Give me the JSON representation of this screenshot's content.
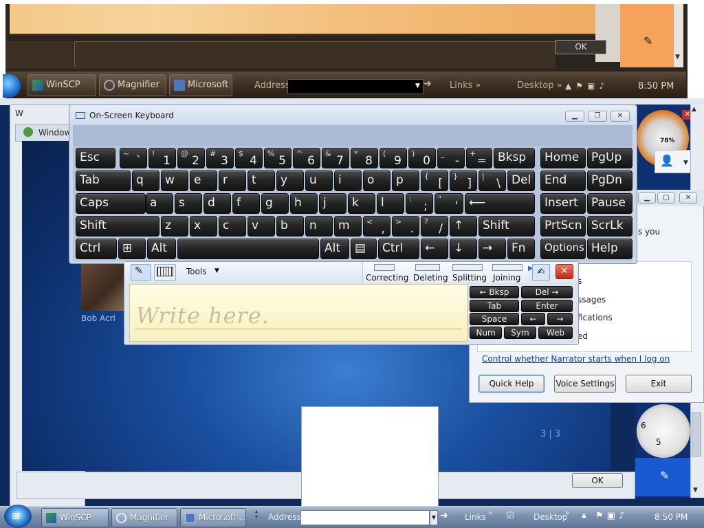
{
  "magnifier": {
    "ok_label": "OK",
    "taskbar": {
      "items": [
        {
          "label": "WinSCP"
        },
        {
          "label": "Magnifier"
        },
        {
          "label": "Microsoft ..."
        }
      ],
      "address_label": "Address",
      "links_label": "Links",
      "desktop_label": "Desktop",
      "clock": "8:50 PM"
    }
  },
  "background": {
    "window_title": "Window",
    "window_title_short": "W",
    "contact_name": "Bob Acri",
    "page_indicator": "3 | 3",
    "ok_label": "OK",
    "battery_percent": "78%"
  },
  "narrator": {
    "text_you": "s you",
    "partial_lines": [
      "s",
      "ssages",
      "fications",
      "ed"
    ],
    "link": "Control whether Narrator starts when I log on",
    "buttons": {
      "quick_help": "Quick Help",
      "voice_settings": "Voice Settings",
      "exit": "Exit"
    }
  },
  "osk": {
    "title": "On-Screen Keyboard",
    "rows": {
      "r1": [
        {
          "lbl": "Esc"
        },
        {
          "top": "~",
          "bot": "`"
        },
        {
          "top": "!",
          "bot": "1"
        },
        {
          "top": "@",
          "bot": "2"
        },
        {
          "top": "#",
          "bot": "3"
        },
        {
          "top": "$",
          "bot": "4"
        },
        {
          "top": "%",
          "bot": "5"
        },
        {
          "top": "^",
          "bot": "6"
        },
        {
          "top": "&",
          "bot": "7"
        },
        {
          "top": "*",
          "bot": "8"
        },
        {
          "top": "(",
          "bot": "9"
        },
        {
          "top": ")",
          "bot": "0"
        },
        {
          "top": "_",
          "bot": "-"
        },
        {
          "top": "+",
          "bot": "="
        },
        {
          "lbl": "Bksp"
        },
        {
          "lbl": "Home"
        },
        {
          "lbl": "PgUp"
        }
      ],
      "r2": [
        {
          "lbl": "Tab"
        },
        {
          "lbl": "q"
        },
        {
          "lbl": "w"
        },
        {
          "lbl": "e"
        },
        {
          "lbl": "r"
        },
        {
          "lbl": "t"
        },
        {
          "lbl": "y"
        },
        {
          "lbl": "u"
        },
        {
          "lbl": "i"
        },
        {
          "lbl": "o"
        },
        {
          "lbl": "p"
        },
        {
          "top": "{",
          "bot": "["
        },
        {
          "top": "}",
          "bot": "]"
        },
        {
          "top": "|",
          "bot": "\\"
        },
        {
          "lbl": "Del"
        },
        {
          "lbl": "End"
        },
        {
          "lbl": "PgDn"
        }
      ],
      "r3": [
        {
          "lbl": "Caps"
        },
        {
          "lbl": "a"
        },
        {
          "lbl": "s"
        },
        {
          "lbl": "d"
        },
        {
          "lbl": "f"
        },
        {
          "lbl": "g"
        },
        {
          "lbl": "h"
        },
        {
          "lbl": "j"
        },
        {
          "lbl": "k"
        },
        {
          "lbl": "l"
        },
        {
          "top": ":",
          "bot": ";"
        },
        {
          "top": "\"",
          "bot": "'"
        },
        {
          "lbl": "⟵"
        },
        {
          "lbl": "Insert"
        },
        {
          "lbl": "Pause"
        }
      ],
      "r4": [
        {
          "lbl": "Shift"
        },
        {
          "lbl": "z"
        },
        {
          "lbl": "x"
        },
        {
          "lbl": "c"
        },
        {
          "lbl": "v"
        },
        {
          "lbl": "b"
        },
        {
          "lbl": "n"
        },
        {
          "lbl": "m"
        },
        {
          "top": "<",
          "bot": ","
        },
        {
          "top": ">",
          "bot": "."
        },
        {
          "top": "?",
          "bot": "/"
        },
        {
          "lbl": "↑"
        },
        {
          "lbl": "Shift"
        },
        {
          "lbl": "PrtScn"
        },
        {
          "lbl": "ScrLk"
        }
      ],
      "r5": [
        {
          "lbl": "Ctrl"
        },
        {
          "lbl": "⊞"
        },
        {
          "lbl": "Alt"
        },
        {
          "lbl": ""
        },
        {
          "lbl": "Alt"
        },
        {
          "lbl": "▤"
        },
        {
          "lbl": "Ctrl"
        },
        {
          "lbl": "←"
        },
        {
          "lbl": "↓"
        },
        {
          "lbl": "→"
        },
        {
          "lbl": "Fn"
        },
        {
          "lbl": "Options"
        },
        {
          "lbl": "Help"
        }
      ]
    }
  },
  "input_panel": {
    "tools_label": "Tools",
    "gestures": [
      "Correcting",
      "Deleting",
      "Splitting",
      "Joining"
    ],
    "placeholder": "Write here.",
    "keys": {
      "bksp": "← Bksp",
      "del": "Del →",
      "tab": "Tab",
      "enter": "Enter",
      "space": "Space",
      "left": "←",
      "right": "→",
      "num": "Num",
      "sym": "Sym",
      "web": "Web"
    }
  },
  "taskbar": {
    "items": [
      {
        "label": "WinSCP"
      },
      {
        "label": "Magnifier"
      },
      {
        "label": "Microsoft ..."
      }
    ],
    "address_label": "Address",
    "links_label": "Links",
    "desktop_label": "Desktop",
    "clock": "8:50 PM"
  }
}
